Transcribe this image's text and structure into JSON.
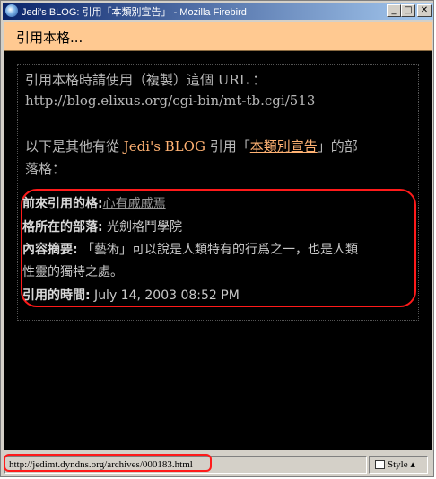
{
  "window": {
    "title": "Jedi's BLOG: 引用「本類別宣告」 - Mozilla Firebird",
    "controls": {
      "minimize": "_",
      "maximize": "□",
      "close": "✕"
    }
  },
  "header": {
    "title": "引用本格..."
  },
  "intro": {
    "line1": "引用本格時請使用（複製）這個 URL ：",
    "url": "http://blog.elixus.org/cgi-bin/mt-tb.cgi/513",
    "line3_prefix": "以下是其他有從 ",
    "blog_link": "Jedi's BLOG",
    "line3_mid": " 引用「",
    "category_link": "本類別宣告",
    "line3_suffix": "」的部",
    "line4": "落格："
  },
  "trackback": {
    "source_label": "前來引用的格:",
    "source_value": "心有戚戚焉",
    "blog_label": "格所在的部落:",
    "blog_value": " 光劍格鬥學院",
    "excerpt_label": "內容摘要:",
    "excerpt_line1": " 「藝術」可以說是人類特有的行爲之一，也是人類",
    "excerpt_line2": "性靈的獨特之處。",
    "time_label": "引用的時間:",
    "time_value": " July 14, 2003 08:52 PM"
  },
  "status": {
    "url": "http://jedimt.dyndns.org/archives/000183.html",
    "style_label": "Style ▴"
  },
  "colors": {
    "header_bg": "#ffc991",
    "link_orange": "#ffb273",
    "callout_red": "#ff1a1a"
  }
}
